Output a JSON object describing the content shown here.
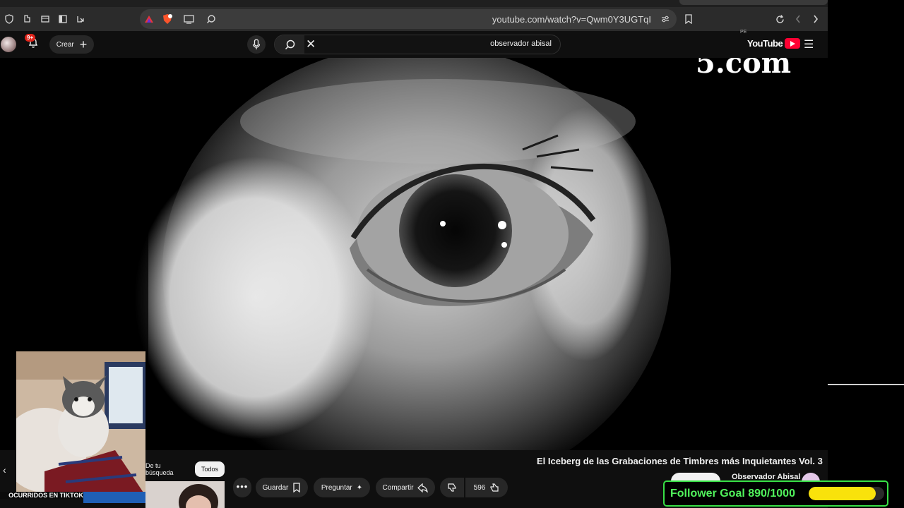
{
  "browser": {
    "url": "youtube.com/watch?v=Qwm0Y3UGTqI",
    "icons": [
      "shield-icon",
      "extensions-icon",
      "tabs-icon",
      "sidebar-icon",
      "share-icon",
      "brave-rewards-icon",
      "brave-shields-icon",
      "cast-icon",
      "search-icon",
      "site-settings-icon",
      "bookmark-icon",
      "reload-icon",
      "back-icon",
      "forward-icon"
    ]
  },
  "youtube": {
    "notification_badge": "9+",
    "create_label": "Crear",
    "search_query": "observador abisal",
    "logo_text": "YouTube",
    "logo_region": "PE"
  },
  "video": {
    "watermark": "5.com",
    "title": "El Iceberg de las Grabaciones de Timbres más Inquietantes Vol. 3",
    "channel": "Observador Abisal",
    "actions": {
      "like_count": "596",
      "share_label": "Compartir",
      "ask_label": "Preguntar",
      "save_label": "Guardar"
    }
  },
  "filters": {
    "chips": [
      "Todos",
      "De tu búsqueda"
    ]
  },
  "overlay": {
    "webcam_caption": "OCURRIDOS EN TIKTOK",
    "goal_label": "Follower Goal 890/1000",
    "goal_current": 890,
    "goal_target": 1000
  },
  "colors": {
    "goal_border": "#38e046",
    "goal_text": "#51f25c",
    "goal_fill": "#f9e20b",
    "yt_red": "#ff0033"
  }
}
